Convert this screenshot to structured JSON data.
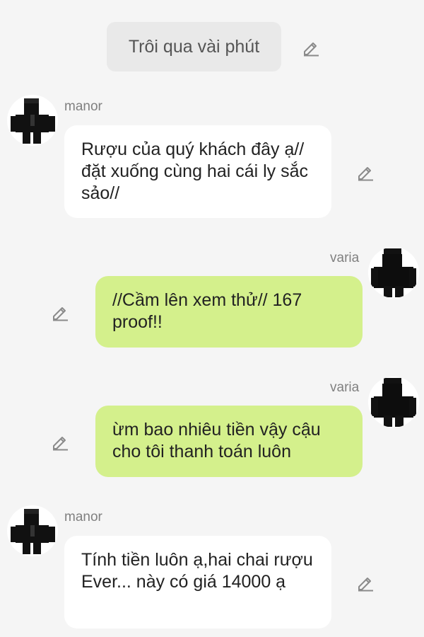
{
  "narration": {
    "label": "Trôi qua vài phút"
  },
  "messages": [
    {
      "sender": "manor",
      "side": "left",
      "text": "Rượu của quý khách đây ạ// đặt xuống cùng hai cái ly sắc sảo//"
    },
    {
      "sender": "varia",
      "side": "right",
      "text": "//Cầm lên xem thử// 167 proof!!"
    },
    {
      "sender": "varia",
      "side": "right",
      "text": "ừm bao nhiêu tiền vậy cậu cho tôi thanh toán luôn"
    },
    {
      "sender": "manor",
      "side": "left",
      "text": "Tính tiền luôn ạ,hai chai rượu Ever... này có giá 14000 ạ"
    }
  ],
  "icons": {
    "edit": "pencil-icon",
    "avatar": "avatar-icon"
  },
  "colors": {
    "background": "#f5f5f5",
    "left_bubble": "#ffffff",
    "right_bubble": "#d4f08c",
    "chip": "#e9e9e9",
    "name_text": "#808080",
    "icon": "#8a8a8a"
  }
}
